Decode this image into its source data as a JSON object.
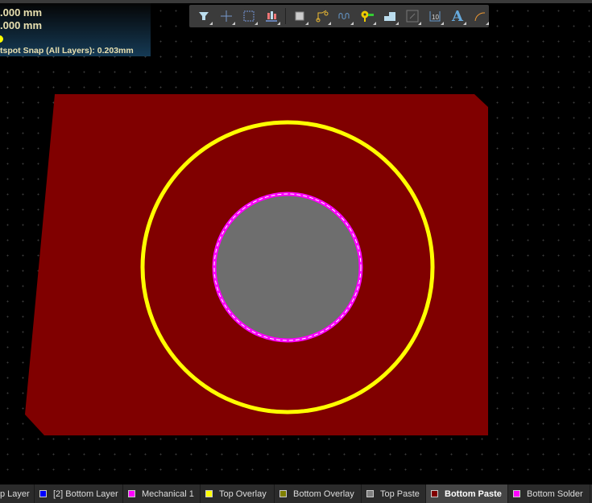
{
  "hud": {
    "x": ".000 mm",
    "y": ".000 mm",
    "snap": "tspot Snap (All Layers): 0.203mm"
  },
  "toolbar": {
    "icons": [
      "filter-icon",
      "crosshair-icon",
      "select-rect-icon",
      "align-icon",
      "component-icon",
      "route-icon",
      "interactive-length-icon",
      "via-icon",
      "polygon-pour-icon",
      "keepout-icon",
      "dimension-icon",
      "text-icon",
      "arc-icon"
    ]
  },
  "colors": {
    "board": "#800000",
    "overlay": "#ffff00",
    "mechanical": "#ff00ff",
    "paste": "#6e6e6e"
  },
  "layers": [
    {
      "label": "p Layer",
      "color": null
    },
    {
      "label": "[2] Bottom Layer",
      "color": "#0000ff"
    },
    {
      "label": "Mechanical 1",
      "color": "#ff00ff"
    },
    {
      "label": "Top Overlay",
      "color": "#ffff00"
    },
    {
      "label": "Bottom Overlay",
      "color": "#808000"
    },
    {
      "label": "Top Paste",
      "color": "#808080"
    },
    {
      "label": "Bottom Paste",
      "color": "#800000",
      "active": true
    },
    {
      "label": "Bottom Solder",
      "color": "#ff00ff"
    }
  ]
}
